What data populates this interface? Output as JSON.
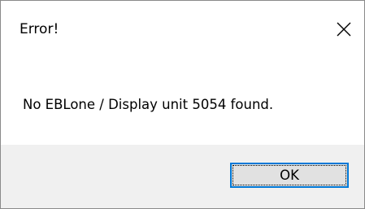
{
  "window": {
    "title": "Error!",
    "close_icon": "close-icon"
  },
  "message": {
    "text": "No EBLone / Display unit 5054 found."
  },
  "buttons": {
    "ok_label": "OK"
  },
  "colors": {
    "focus_border": "#0078d7",
    "button_face": "#e1e1e1",
    "footer_background": "#f0f0f0"
  }
}
